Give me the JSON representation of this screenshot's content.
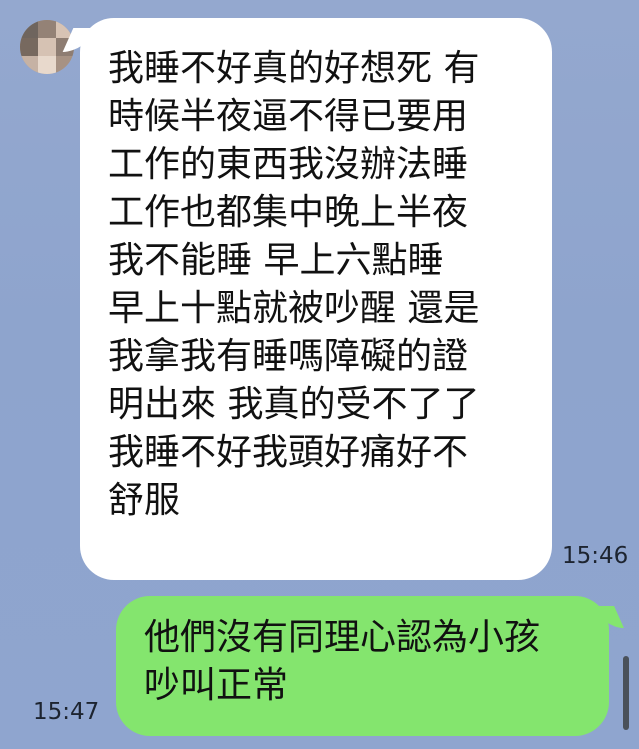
{
  "avatar": {
    "name": "avatar",
    "colors": [
      "#6f655e",
      "#948276",
      "#d7c3b4",
      "#77695f",
      "#d6c2b3",
      "#8e7d72",
      "#c6b2a4",
      "#e8d9cc",
      "#a79283"
    ]
  },
  "messages": [
    {
      "type": "incoming",
      "lines": [
        "我睡不好真的好想死 有",
        "時候半夜逼不得已要用",
        "工作的東西我沒辦法睡",
        "工作也都集中晚上半夜",
        "我不能睡 早上六點睡",
        "早上十點就被吵醒 還是",
        "我拿我有睡嗎障礙的證",
        "明出來 我真的受不了了",
        "我睡不好我頭好痛好不",
        "舒服"
      ],
      "time": "15:46"
    },
    {
      "type": "outgoing",
      "lines": [
        "他們沒有同理心認為小孩",
        "吵叫正常"
      ],
      "time": "15:47"
    }
  ],
  "colors": {
    "background": "#8fa5cf",
    "incoming_bubble": "#ffffff",
    "outgoing_bubble": "#84e56e",
    "text": "#111111",
    "time": "#1d2430"
  }
}
